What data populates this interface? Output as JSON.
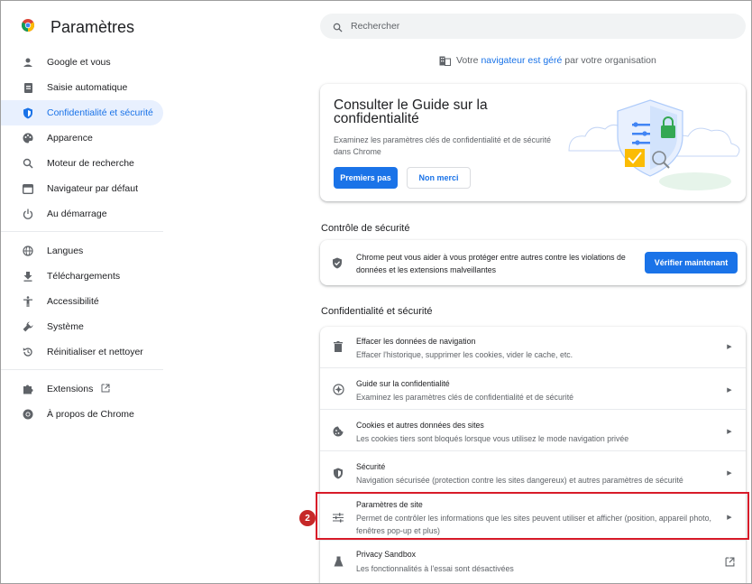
{
  "app": {
    "title": "Paramètres"
  },
  "sidebar": {
    "items": [
      {
        "label": "Google et vous",
        "icon": "person-icon"
      },
      {
        "label": "Saisie automatique",
        "icon": "clipboard-icon"
      },
      {
        "label": "Confidentialité et sécurité",
        "icon": "shield-icon",
        "active": true
      },
      {
        "label": "Apparence",
        "icon": "palette-icon"
      },
      {
        "label": "Moteur de recherche",
        "icon": "search-icon"
      },
      {
        "label": "Navigateur par défaut",
        "icon": "browser-icon"
      },
      {
        "label": "Au démarrage",
        "icon": "power-icon"
      },
      {
        "label": "Langues",
        "icon": "globe-icon"
      },
      {
        "label": "Téléchargements",
        "icon": "download-icon"
      },
      {
        "label": "Accessibilité",
        "icon": "accessibility-icon"
      },
      {
        "label": "Système",
        "icon": "wrench-icon"
      },
      {
        "label": "Réinitialiser et nettoyer",
        "icon": "reset-icon"
      },
      {
        "label": "Extensions",
        "icon": "puzzle-icon"
      },
      {
        "label": "À propos de Chrome",
        "icon": "chrome-icon"
      }
    ]
  },
  "search": {
    "placeholder": "Rechercher"
  },
  "managed": {
    "prefix": "Votre",
    "link": "navigateur est géré",
    "suffix": "par votre organisation"
  },
  "guide": {
    "title": "Consulter le Guide sur la confidentialité",
    "description": "Examinez les paramètres clés de confidentialité et de sécurité dans Chrome",
    "primary_label": "Premiers pas",
    "secondary_label": "Non merci"
  },
  "safety": {
    "heading": "Contrôle de sécurité",
    "text": "Chrome peut vous aider à vous protéger entre autres contre les violations de données et les extensions malveillantes",
    "button_label": "Vérifier maintenant"
  },
  "privacy": {
    "heading": "Confidentialité et sécurité",
    "rows": [
      {
        "title": "Effacer les données de navigation",
        "desc": "Effacer l'historique, supprimer les cookies, vider le cache, etc.",
        "icon": "trash-icon"
      },
      {
        "title": "Guide sur la confidentialité",
        "desc": "Examinez les paramètres clés de confidentialité et de sécurité",
        "icon": "compass-icon"
      },
      {
        "title": "Cookies et autres données des sites",
        "desc": "Les cookies tiers sont bloqués lorsque vous utilisez le mode navigation privée",
        "icon": "cookie-icon"
      },
      {
        "title": "Sécurité",
        "desc": "Navigation sécurisée (protection contre les sites dangereux) et autres paramètres de sécurité",
        "icon": "shield-icon"
      },
      {
        "title": "Paramètres de site",
        "desc": "Permet de contrôler les informations que les sites peuvent utiliser et afficher (position, appareil photo, fenêtres pop-up et plus)",
        "icon": "sliders-icon"
      },
      {
        "title": "Privacy Sandbox",
        "desc": "Les fonctionnalités à l'essai sont désactivées",
        "icon": "flask-icon"
      }
    ]
  },
  "annotation": {
    "step_number": "2"
  },
  "colors": {
    "accent": "#1a73e8",
    "highlight": "#d81b29",
    "active_bg": "#e8f0fe"
  }
}
